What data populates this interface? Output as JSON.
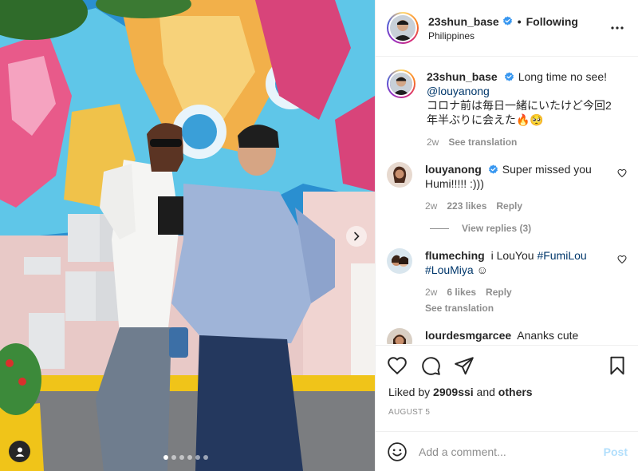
{
  "header": {
    "username": "23shun_base",
    "separator": "•",
    "follow_state": "Following",
    "location": "Philippines"
  },
  "caption": {
    "username": "23shun_base",
    "text": "Long time no see!",
    "mention": "@louyanong",
    "text_jp": "コロナ前は毎日一緒にいたけど今回2年半ぶりに会えた🔥🥺",
    "age": "2w",
    "see_translation": "See translation"
  },
  "comments": [
    {
      "username": "louyanong",
      "text": "Super missed you Humi!!!!! :)))",
      "age": "2w",
      "likes": "223 likes",
      "reply": "Reply",
      "view_replies": "View replies (3)"
    },
    {
      "username": "flumeching",
      "text": "i LouYou",
      "hashtag1": "#FumiLou",
      "hashtag2": "#LouMiya",
      "emoji": "☺",
      "age": "2w",
      "likes": "6 likes",
      "reply": "Reply",
      "see_translation": "See translation"
    },
    {
      "username": "lourdesmgarcee",
      "text": "Ananks cute"
    }
  ],
  "likes_line": {
    "prefix": "Liked by",
    "user": "2909ssi",
    "and": "and",
    "others": "others"
  },
  "date": "AUGUST 5",
  "add_comment": {
    "placeholder": "Add a comment...",
    "post_label": "Post"
  },
  "carousel": {
    "total": 6,
    "active": 1
  },
  "colors": {
    "link": "#00376b",
    "verified": "#3897f0",
    "post_disabled": "#b2dffc",
    "muted": "#8e8e8e"
  }
}
